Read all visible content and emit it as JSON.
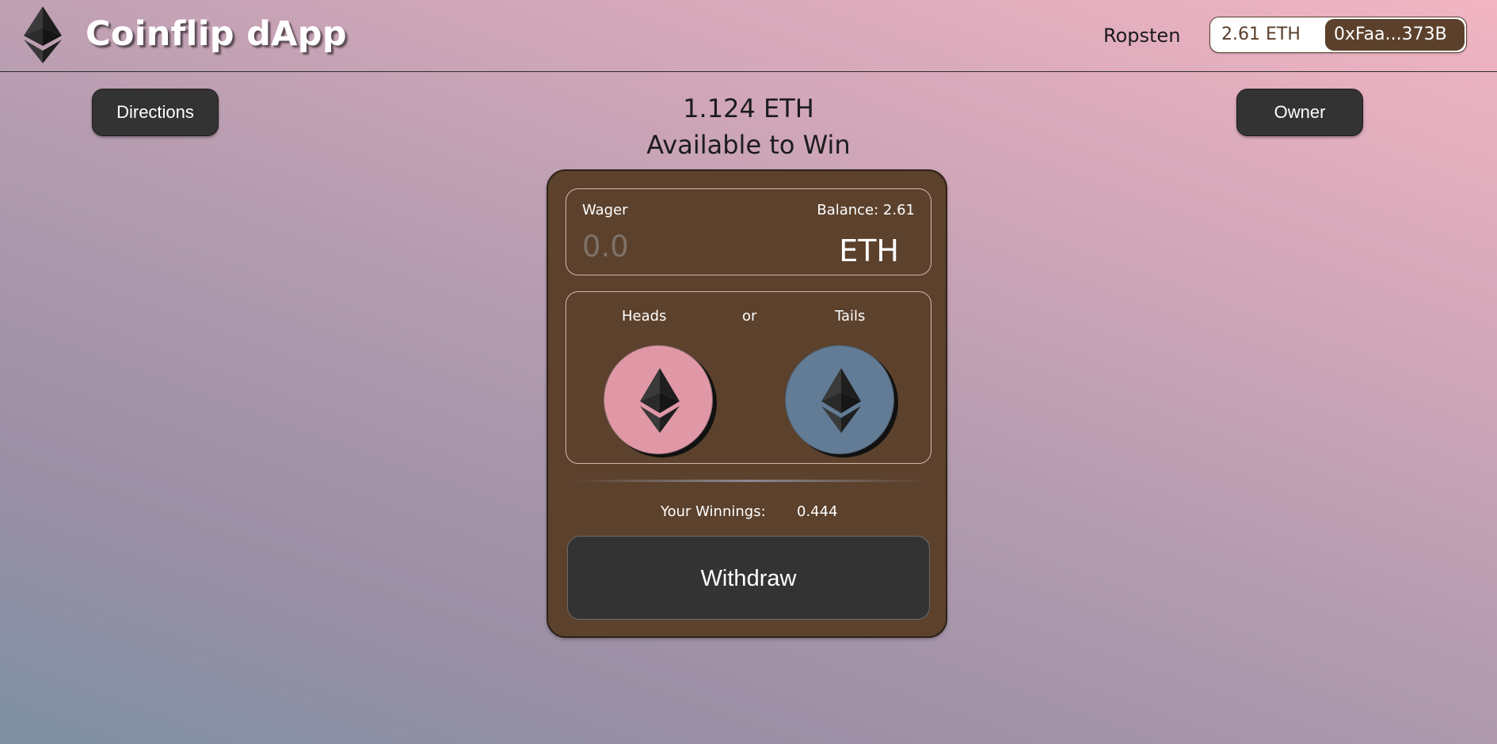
{
  "header": {
    "app_title": "Coinflip dApp",
    "logo_icon": "ethereum-logo-icon",
    "network": "Ropsten",
    "wallet_balance": "2.61 ETH",
    "wallet_address": "0xFaa...373B"
  },
  "controls": {
    "directions_label": "Directions",
    "owner_label": "Owner"
  },
  "prize": {
    "amount": "1.124 ETH",
    "caption": "Available to Win"
  },
  "wager": {
    "label": "Wager",
    "balance_label": "Balance:  2.61",
    "placeholder": "0.0",
    "unit": "ETH"
  },
  "coins": {
    "heads_label": "Heads",
    "or_label": "or",
    "tails_label": "Tails",
    "heads_icon": "ethereum-icon",
    "tails_icon": "ethereum-icon",
    "heads_color": "#e198a6",
    "tails_color": "#627c96"
  },
  "winnings": {
    "label": "Your Winnings:",
    "value": "0.444"
  },
  "withdraw_label": "Withdraw",
  "colors": {
    "card": "#5c412c",
    "button": "#333333",
    "title": "#ffffff"
  }
}
